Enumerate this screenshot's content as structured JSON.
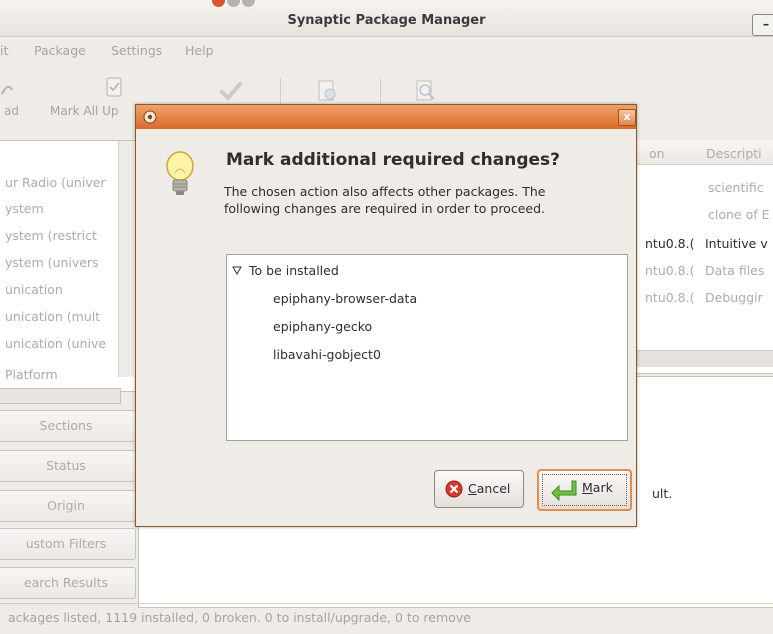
{
  "window": {
    "title": "Synaptic Package Manager",
    "minimize_label": "–"
  },
  "menubar": [
    {
      "label": "it"
    },
    {
      "label": "Package"
    },
    {
      "label": "Settings"
    },
    {
      "label": "Help"
    }
  ],
  "toolbar": {
    "reload_label": "ad",
    "mark_all_label": "Mark All Up"
  },
  "sections": [
    "ur Radio (univer",
    "ystem",
    "ystem (restrict",
    "ystem (univers",
    "unication",
    "unication (mult",
    "unication (unive",
    "Platform"
  ],
  "filter_buttons": [
    "Sections",
    "Status",
    "Origin",
    "ustom Filters",
    "earch Results"
  ],
  "package_table": {
    "columns": [
      "on",
      "Descripti"
    ],
    "rows": [
      {
        "version": "",
        "description": "scientific",
        "dim": true
      },
      {
        "version": "",
        "description": "clone of E",
        "dim": true
      },
      {
        "version": "ntu0.8.(",
        "description": "Intuitive v",
        "dim": false
      },
      {
        "version": "ntu0.8.(",
        "description": "Data files",
        "dim": true
      },
      {
        "version": "ntu0.8.(",
        "description": "Debuggir",
        "dim": true
      }
    ],
    "description_fragment": "ult."
  },
  "statusbar": {
    "text": "ackages listed, 1119 installed, 0 broken. 0 to install/upgrade, 0 to remove"
  },
  "dialog": {
    "heading": "Mark additional required changes?",
    "message": "The chosen action also affects other packages. The following changes are required in order to proceed.",
    "close_symbol": "x",
    "tree": {
      "group_label": "To be installed",
      "items": [
        "epiphany-browser-data",
        "epiphany-gecko",
        "libavahi-gobject0"
      ]
    },
    "buttons": {
      "cancel": {
        "mnemonic": "C",
        "rest": "ancel"
      },
      "mark": {
        "mnemonic": "M",
        "rest": "ark"
      }
    }
  },
  "colors": {
    "dialog_titlebar": "#e07a3a",
    "focus_border": "#e48c4f",
    "cancel_icon": "#d63a2e",
    "mark_icon": "#5fb33a"
  }
}
